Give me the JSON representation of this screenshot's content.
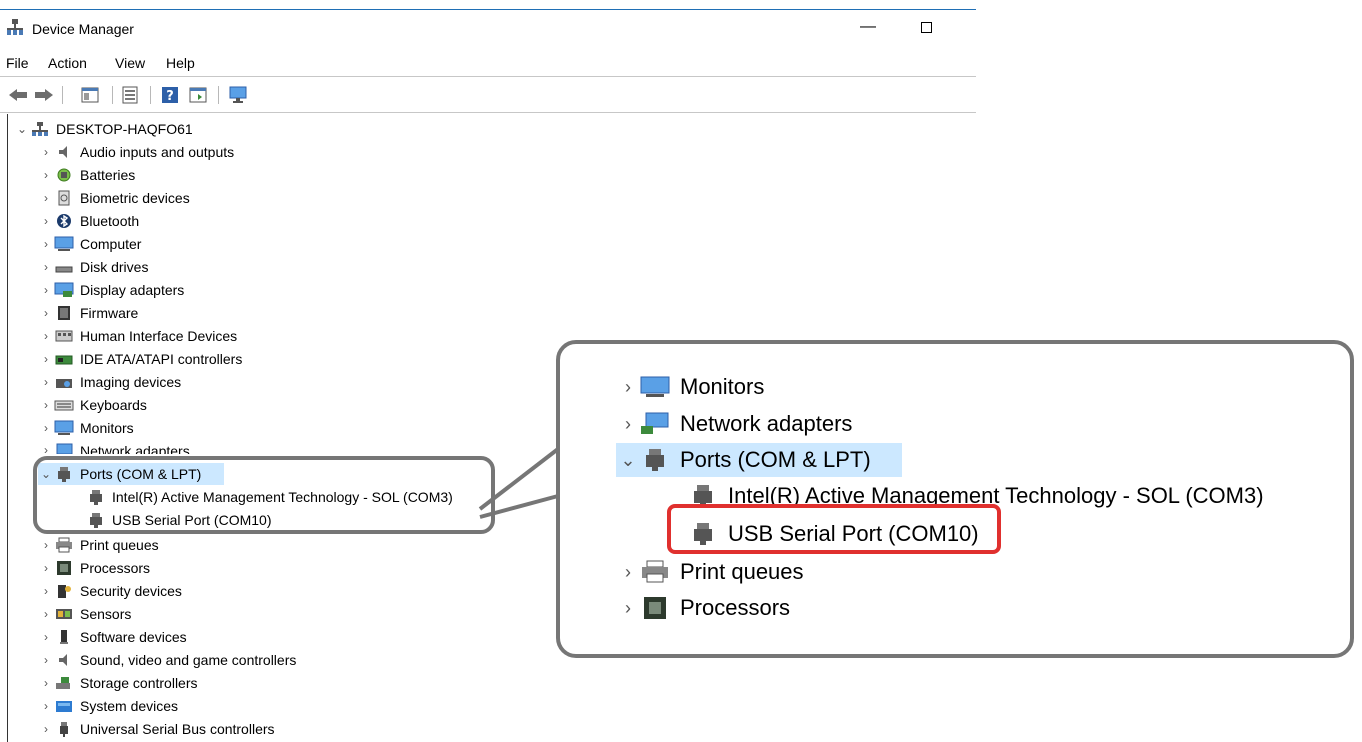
{
  "window": {
    "title": "Device Manager",
    "menu": [
      "File",
      "Action",
      "View",
      "Help"
    ]
  },
  "tree": {
    "root": "DESKTOP-HAQFO61",
    "categories": [
      "Audio inputs and outputs",
      "Batteries",
      "Biometric devices",
      "Bluetooth",
      "Computer",
      "Disk drives",
      "Display adapters",
      "Firmware",
      "Human Interface Devices",
      "IDE ATA/ATAPI controllers",
      "Imaging devices",
      "Keyboards",
      "Monitors",
      "Network adapters",
      "Ports (COM & LPT)",
      "Print queues",
      "Processors",
      "Security devices",
      "Sensors",
      "Software devices",
      "Sound, video and game controllers",
      "Storage controllers",
      "System devices",
      "Universal Serial Bus controllers"
    ],
    "ports_children": [
      "Intel(R) Active Management Technology - SOL (COM3)",
      "USB Serial Port (COM10)"
    ]
  },
  "zoom": {
    "rows": [
      "Monitors",
      "Network adapters",
      "Ports (COM & LPT)",
      "Intel(R) Active Management Technology - SOL (COM3)",
      "USB Serial Port (COM10)",
      "Print queues",
      "Processors"
    ]
  },
  "colors": {
    "selection": "#cce8ff",
    "highlight": "#e0302e",
    "callout_border": "#767676"
  }
}
